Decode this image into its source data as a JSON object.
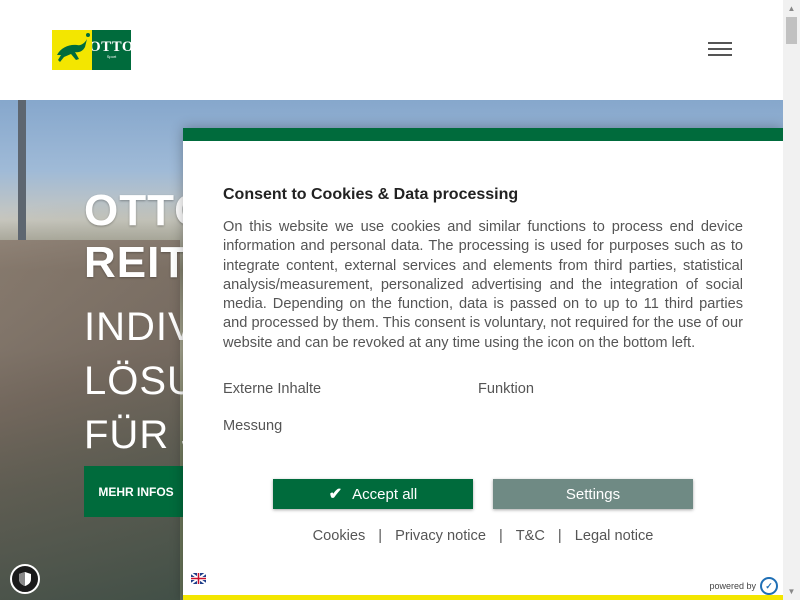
{
  "header": {
    "logo": {
      "wordmark": "OTTO",
      "sub": "Sport"
    },
    "menu_icon": "hamburger-icon"
  },
  "hero": {
    "title_lines": [
      "OTTO",
      "REITI"
    ],
    "subtitle_lines": [
      "INDIVI",
      "LÖSUN",
      "FÜR JE"
    ],
    "button_label": "MEHR INFOS"
  },
  "consent": {
    "title": "Consent to Cookies & Data processing",
    "text": "On this website we use cookies and similar functions to process end device information and personal data. The processing is used for purposes such as to integrate content, external services and elements from third parties, statistical analysis/measurement, personalized advertising and the integration of social media. Depending on the function, data is passed on to up to 11 third parties and processed by them. This consent is voluntary, not required for the use of our website and can be revoked at any time using the icon on the bottom left.",
    "options": [
      "Externe Inhalte",
      "Funktion",
      "Messung"
    ],
    "accept_label": "Accept all",
    "settings_label": "Settings",
    "links": [
      "Cookies",
      "Privacy notice",
      "T&C",
      "Legal notice"
    ],
    "separator": "|",
    "powered_by": "powered by"
  },
  "colors": {
    "brand_green": "#006b3c",
    "brand_yellow": "#f3e600",
    "settings_gray": "#6f8a84"
  }
}
